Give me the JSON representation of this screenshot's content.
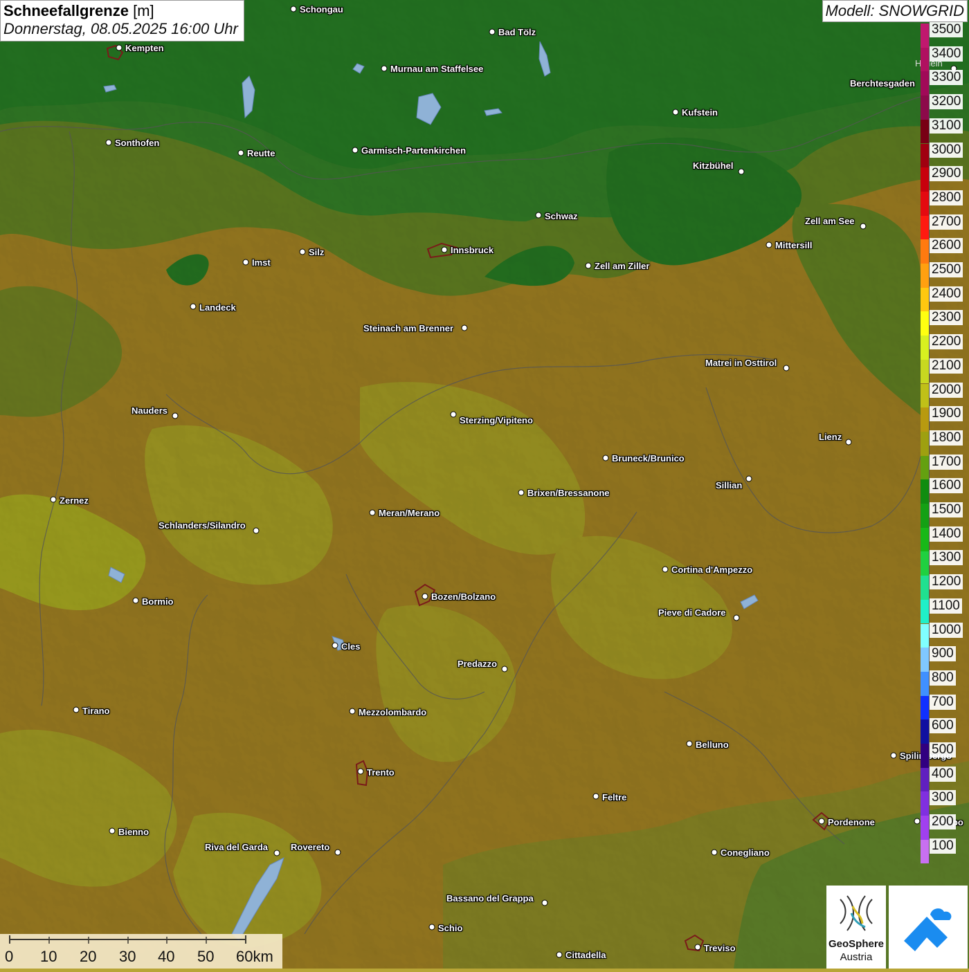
{
  "title": {
    "main_bold": "Schneefallgrenze",
    "main_unit": "[m]",
    "date": "Donnerstag, 08.05.2025 16:00 Uhr"
  },
  "model": "Modell: SNOWGRID",
  "legend": [
    {
      "label": "3500",
      "color": "#c0186e"
    },
    {
      "label": "3400",
      "color": "#b01060"
    },
    {
      "label": "3300",
      "color": "#a00a58"
    },
    {
      "label": "3200",
      "color": "#8c0a4a"
    },
    {
      "label": "3100",
      "color": "#780014"
    },
    {
      "label": "3000",
      "color": "#a00010"
    },
    {
      "label": "2900",
      "color": "#c8000c"
    },
    {
      "label": "2800",
      "color": "#e40a10"
    },
    {
      "label": "2700",
      "color": "#ff1a10"
    },
    {
      "label": "2600",
      "color": "#ff7a10"
    },
    {
      "label": "2500",
      "color": "#ffa010"
    },
    {
      "label": "2400",
      "color": "#ffc810"
    },
    {
      "label": "2300",
      "color": "#ffff10"
    },
    {
      "label": "2200",
      "color": "#d8f020"
    },
    {
      "label": "2100",
      "color": "#c8d820"
    },
    {
      "label": "2000",
      "color": "#c0c018"
    },
    {
      "label": "1900",
      "color": "#b89a10"
    },
    {
      "label": "1800",
      "color": "#9ea010"
    },
    {
      "label": "1700",
      "color": "#64a010"
    },
    {
      "label": "1600",
      "color": "#108c10"
    },
    {
      "label": "1500",
      "color": "#14a014"
    },
    {
      "label": "1400",
      "color": "#18b818"
    },
    {
      "label": "1300",
      "color": "#20d040"
    },
    {
      "label": "1200",
      "color": "#20e090"
    },
    {
      "label": "1100",
      "color": "#20f0c8"
    },
    {
      "label": "1000",
      "color": "#80ffff"
    },
    {
      "label": "900",
      "color": "#80c8ff"
    },
    {
      "label": "800",
      "color": "#4090ff"
    },
    {
      "label": "700",
      "color": "#1030ff"
    },
    {
      "label": "600",
      "color": "#1010a0"
    },
    {
      "label": "500",
      "color": "#300080"
    },
    {
      "label": "400",
      "color": "#6020c0"
    },
    {
      "label": "300",
      "color": "#8030e0"
    },
    {
      "label": "200",
      "color": "#a040f0"
    },
    {
      "label": "100",
      "color": "#c870f0"
    }
  ],
  "scale": [
    "0",
    "10",
    "20",
    "30",
    "40",
    "50",
    "60km"
  ],
  "logos": {
    "geosphere_line1": "GeoSphere",
    "geosphere_line2": "Austria"
  },
  "cities": [
    {
      "name": "Schongau",
      "label_side": "right"
    },
    {
      "name": "Bad Tölz",
      "label_side": "right"
    },
    {
      "name": "Kempten",
      "label_side": "right"
    },
    {
      "name": "Murnau am Staffelsee",
      "label_side": "right"
    },
    {
      "name": "Hallein",
      "label_side": "left"
    },
    {
      "name": "Berchtesgaden",
      "label_side": "left"
    },
    {
      "name": "Kufstein",
      "label_side": "right"
    },
    {
      "name": "Sonthofen",
      "label_side": "right"
    },
    {
      "name": "Reutte",
      "label_side": "right"
    },
    {
      "name": "Garmisch-Partenkirchen",
      "label_side": "right"
    },
    {
      "name": "Kitzbühel",
      "label_side": "left"
    },
    {
      "name": "Schwaz",
      "label_side": "right"
    },
    {
      "name": "Zell am See",
      "label_side": "left"
    },
    {
      "name": "Mittersill",
      "label_side": "right"
    },
    {
      "name": "Innsbruck",
      "label_side": "right"
    },
    {
      "name": "Imst",
      "label_side": "right"
    },
    {
      "name": "Silz",
      "label_side": "right"
    },
    {
      "name": "Zell am Ziller",
      "label_side": "right"
    },
    {
      "name": "Landeck",
      "label_side": "right"
    },
    {
      "name": "Steinach am Brenner",
      "label_side": "left"
    },
    {
      "name": "Matrei in Osttirol",
      "label_side": "left"
    },
    {
      "name": "Nauders",
      "label_side": "left"
    },
    {
      "name": "Sterzing/Vipiteno",
      "label_side": "right"
    },
    {
      "name": "Lienz",
      "label_side": "left"
    },
    {
      "name": "Bruneck/Brunico",
      "label_side": "right"
    },
    {
      "name": "Sillian",
      "label_side": "left"
    },
    {
      "name": "Zernez",
      "label_side": "right"
    },
    {
      "name": "Brixen/Bressanone",
      "label_side": "right"
    },
    {
      "name": "Meran/Merano",
      "label_side": "right"
    },
    {
      "name": "Schlanders/Silandro",
      "label_side": "left"
    },
    {
      "name": "Cortina d'Ampezzo",
      "label_side": "right"
    },
    {
      "name": "Bozen/Bolzano",
      "label_side": "right"
    },
    {
      "name": "Bormio",
      "label_side": "right"
    },
    {
      "name": "Pieve di Cadore",
      "label_side": "left"
    },
    {
      "name": "Cles",
      "label_side": "right"
    },
    {
      "name": "Predazzo",
      "label_side": "left"
    },
    {
      "name": "Tirano",
      "label_side": "right"
    },
    {
      "name": "Mezzolombardo",
      "label_side": "right"
    },
    {
      "name": "Belluno",
      "label_side": "right"
    },
    {
      "name": "Spilimbergo",
      "label_side": "right"
    },
    {
      "name": "Trento",
      "label_side": "right"
    },
    {
      "name": "Feltre",
      "label_side": "right"
    },
    {
      "name": "Pordenone",
      "label_side": "right"
    },
    {
      "name": "Codroipo",
      "label_side": "right"
    },
    {
      "name": "Bienno",
      "label_side": "right"
    },
    {
      "name": "Riva del Garda",
      "label_side": "left"
    },
    {
      "name": "Rovereto",
      "label_side": "left"
    },
    {
      "name": "Conegliano",
      "label_side": "right"
    },
    {
      "name": "Bassano del Grappa",
      "label_side": "left"
    },
    {
      "name": "Schio",
      "label_side": "right"
    },
    {
      "name": "Cittadella",
      "label_side": "right"
    },
    {
      "name": "Treviso",
      "label_side": "right"
    }
  ]
}
